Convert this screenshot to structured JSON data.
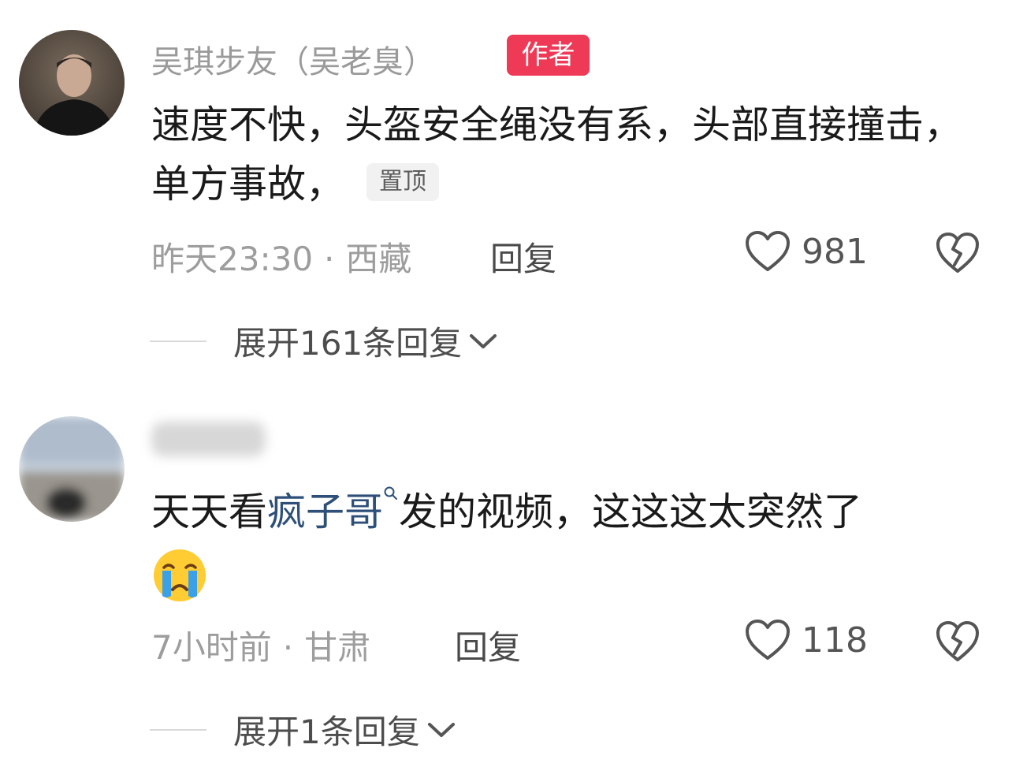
{
  "comments": [
    {
      "username": "吴琪步友（吴老臭）",
      "badge": "作者",
      "text": "速度不快，头盔安全绳没有系，头部直接撞击，单方事故，",
      "pinned_label": "置顶",
      "time": "昨天23:30",
      "location": "西藏",
      "reply_label": "回复",
      "likes": "981",
      "expand_label": "展开161条回复"
    },
    {
      "username": "",
      "text_before": "天天看",
      "link_text": "疯子哥",
      "text_after": "发的视频，这这这太突然了",
      "emoji": "crying-face-emoji",
      "time": "7小时前",
      "location": "甘肃",
      "reply_label": "回复",
      "likes": "118",
      "expand_label": "展开1条回复"
    }
  ],
  "separator": "·",
  "colors": {
    "badge_bg": "#ee3a56",
    "link": "#2d4f78",
    "meta": "#9d9d9d"
  },
  "icons": [
    "heart-icon",
    "broken-heart-icon",
    "chevron-down-icon",
    "search-icon"
  ]
}
